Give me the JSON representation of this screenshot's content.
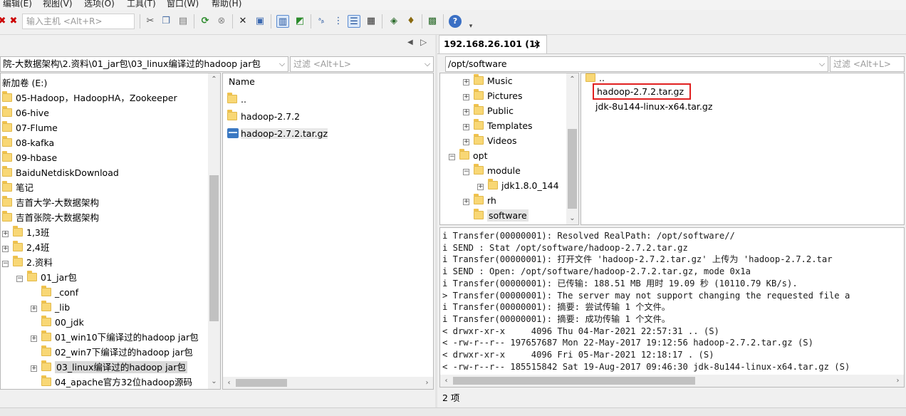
{
  "menu": {
    "items": [
      "编辑(E)",
      "视图(V)",
      "选项(O)",
      "工具(T)",
      "窗口(W)",
      "帮助(H)"
    ]
  },
  "toolbar": {
    "host_input_placeholder": "输入主机 <Alt+R>",
    "icons": [
      "disconnect-icon",
      "cut-icon",
      "copy-icon",
      "paste-icon",
      "refresh-icon",
      "stop-icon",
      "delete-icon",
      "properties-icon",
      "view-icon",
      "upload-icon",
      "rename-icon",
      "list-icon",
      "details-icon",
      "chmod-icon",
      "bookmark-icon",
      "sync-icon",
      "help-icon"
    ]
  },
  "left": {
    "nav_arrows": [
      "◀",
      "▷"
    ],
    "path": "院-大数据架构\\2.资料\\01_jar包\\03_linux编译过的hadoop jar包",
    "filter_placeholder": "过滤 <Alt+L>",
    "tree": [
      {
        "label": "新加卷 (E:)",
        "indent": 0,
        "icon": "none",
        "expander": ""
      },
      {
        "label": "05-Hadoop，HadoopHA，Zookeeper",
        "indent": 0,
        "icon": "folder",
        "expander": ""
      },
      {
        "label": "06-hive",
        "indent": 0,
        "icon": "folder",
        "expander": ""
      },
      {
        "label": "07-Flume",
        "indent": 0,
        "icon": "folder",
        "expander": ""
      },
      {
        "label": "08-kafka",
        "indent": 0,
        "icon": "folder",
        "expander": ""
      },
      {
        "label": "09-hbase",
        "indent": 0,
        "icon": "folder",
        "expander": ""
      },
      {
        "label": "BaiduNetdiskDownload",
        "indent": 0,
        "icon": "folder",
        "expander": ""
      },
      {
        "label": "笔记",
        "indent": 0,
        "icon": "folder",
        "expander": ""
      },
      {
        "label": "吉首大学-大数据架构",
        "indent": 0,
        "icon": "folder",
        "expander": ""
      },
      {
        "label": "吉首张院-大数据架构",
        "indent": 0,
        "icon": "folder",
        "expander": ""
      },
      {
        "label": "1,3班",
        "indent": 1,
        "icon": "folder",
        "expander": "+"
      },
      {
        "label": "2,4班",
        "indent": 1,
        "icon": "folder",
        "expander": "+"
      },
      {
        "label": "2.资料",
        "indent": 1,
        "icon": "folder",
        "expander": "−"
      },
      {
        "label": "01_jar包",
        "indent": 2,
        "icon": "folder",
        "expander": "−"
      },
      {
        "label": "_conf",
        "indent": 3,
        "icon": "folder",
        "expander": ""
      },
      {
        "label": "_lib",
        "indent": 3,
        "icon": "folder",
        "expander": "+"
      },
      {
        "label": "00_jdk",
        "indent": 3,
        "icon": "folder",
        "expander": ""
      },
      {
        "label": "01_win10下编译过的hadoop jar包",
        "indent": 3,
        "icon": "folder",
        "expander": "+"
      },
      {
        "label": "02_win7下编译过的hadoop jar包",
        "indent": 3,
        "icon": "folder",
        "expander": ""
      },
      {
        "label": "03_linux编译过的hadoop jar包",
        "indent": 3,
        "icon": "folder",
        "expander": "+",
        "selected": true
      },
      {
        "label": "04_apache官方32位hadoop源码",
        "indent": 3,
        "icon": "folder",
        "expander": ""
      }
    ],
    "files_header": "Name",
    "files": [
      {
        "label": "..",
        "icon": "folder"
      },
      {
        "label": "hadoop-2.7.2",
        "icon": "folder"
      },
      {
        "label": "hadoop-2.7.2.tar.gz",
        "icon": "archive"
      }
    ]
  },
  "right": {
    "tab_label": "192.168.26.101 (1)",
    "tab_close": "×",
    "path": "/opt/software",
    "filter_placeholder": "过滤 <Alt+L>",
    "tree": [
      {
        "label": "Music",
        "indent": 1,
        "expander": "+"
      },
      {
        "label": "Pictures",
        "indent": 1,
        "expander": "+"
      },
      {
        "label": "Public",
        "indent": 1,
        "expander": "+"
      },
      {
        "label": "Templates",
        "indent": 1,
        "expander": "+"
      },
      {
        "label": "Videos",
        "indent": 1,
        "expander": "+"
      },
      {
        "label": "opt",
        "indent": 0,
        "expander": "−"
      },
      {
        "label": "module",
        "indent": 1,
        "expander": "−"
      },
      {
        "label": "jdk1.8.0_144",
        "indent": 2,
        "expander": "+"
      },
      {
        "label": "rh",
        "indent": 1,
        "expander": "+"
      },
      {
        "label": "software",
        "indent": 1,
        "expander": "",
        "selected": true
      }
    ],
    "files": [
      {
        "label": "..",
        "icon": "folder"
      },
      {
        "label": "hadoop-2.7.2.tar.gz",
        "icon": "none",
        "highlighted": true
      },
      {
        "label": "jdk-8u144-linux-x64.tar.gz",
        "icon": "none"
      }
    ],
    "highlight_color": "#e02020",
    "log": [
      "i Transfer(00000001): Resolved RealPath: /opt/software//",
      "i SEND : Stat /opt/software/hadoop-2.7.2.tar.gz",
      "i Transfer(00000001): 打开文件 'hadoop-2.7.2.tar.gz' 上传为 'hadoop-2.7.2.tar",
      "i SEND : Open: /opt/software/hadoop-2.7.2.tar.gz, mode 0x1a",
      "i Transfer(00000001): 已传输: 188.51 MB 用时 19.09 秒 (10110.79 KB/s).",
      "> Transfer(00000001): The server may not support changing the requested file a",
      "i Transfer(00000001): 摘要: 尝试传输 1 个文件。",
      "i Transfer(00000001): 摘要: 成功传输 1 个文件。",
      "< drwxr-xr-x     4096 Thu 04-Mar-2021 22:57:31 .. (S)",
      "< -rw-r--r-- 197657687 Mon 22-May-2017 19:12:56 hadoop-2.7.2.tar.gz (S)",
      "< drwxr-xr-x     4096 Fri 05-Mar-2021 12:18:17 . (S)",
      "< -rw-r--r-- 185515842 Sat 19-Aug-2017 09:46:30 jdk-8u144-linux-x64.tar.gz (S)"
    ],
    "status": "2 项"
  }
}
